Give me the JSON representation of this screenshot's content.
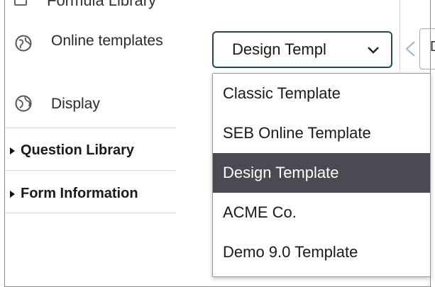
{
  "sidebar": {
    "top_item": "Formula Library",
    "online_templates": "Online templates",
    "display": "Display",
    "sections": [
      "Question Library",
      "Form Information"
    ]
  },
  "template_select": {
    "value": "Design Templ",
    "options": [
      "Classic Template",
      "SEB Online Template",
      "Design Template",
      "ACME Co.",
      "Demo 9.0 Template"
    ],
    "selected_option": "Design Template"
  },
  "right_field": {
    "text": "D"
  },
  "colors": {
    "select_border": "#1f4d4d",
    "selected_bg": "#4a4a52"
  }
}
